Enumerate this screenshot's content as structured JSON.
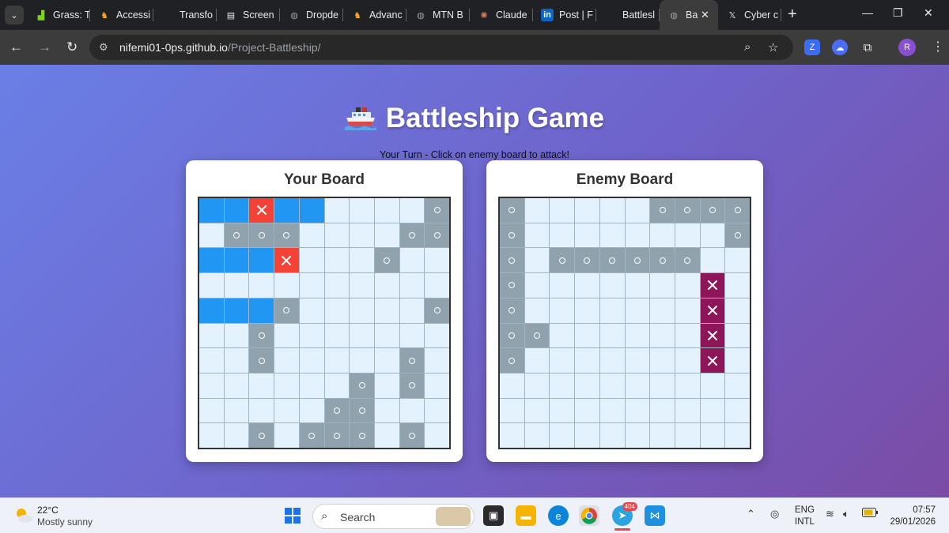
{
  "browser": {
    "tabs": [
      {
        "label": "Grass: T",
        "icon": "grass-icon",
        "color": "#7ed321"
      },
      {
        "label": "Accessi",
        "icon": "fox-icon",
        "color": "#f5a623"
      },
      {
        "label": "Transfo",
        "icon": "blank-icon",
        "color": "#202124"
      },
      {
        "label": "Screen",
        "icon": "screen-icon",
        "color": "#e8eaed"
      },
      {
        "label": "Dropde",
        "icon": "globe-icon",
        "color": "#9aa0a6"
      },
      {
        "label": "Advanc",
        "icon": "fox-icon",
        "color": "#f5a623"
      },
      {
        "label": "MTN B",
        "icon": "globe-icon",
        "color": "#9aa0a6"
      },
      {
        "label": "Claude",
        "icon": "claude-icon",
        "color": "#d97757"
      },
      {
        "label": "Post | F",
        "icon": "linkedin-icon",
        "color": "#0a66c2"
      },
      {
        "label": "Battlesl",
        "icon": "blank-icon",
        "color": "#202124"
      },
      {
        "label": "Ba",
        "icon": "globe-icon",
        "color": "#9aa0a6",
        "active": true
      },
      {
        "label": "Cyber c",
        "icon": "x-icon",
        "color": "#e8eaed"
      }
    ],
    "url_host": "nifemi01-0ps.github.io",
    "url_path": "/Project-Battleship/",
    "profile_initial": "R"
  },
  "page": {
    "title": "Battleship Game",
    "status": "Your Turn - Click on enemy board to attack!"
  },
  "boards": [
    {
      "title": "Your Board",
      "rows": [
        "SSHSS----M",
        "-MMM----MM",
        "SSSH---M--",
        "----------",
        "SSSM-----M",
        "--M-------",
        "--M-----M-",
        "------M-M-",
        "-----MM---",
        "--M-MMM-M-"
      ]
    },
    {
      "title": "Enemy Board",
      "rows": [
        "M-----MMMM",
        "M--------M",
        "M-MMMMMM--",
        "M-------X-",
        "M-------X-",
        "MM------X-",
        "M-------X-",
        "----------",
        "----------",
        "----------"
      ]
    }
  ],
  "legend": {
    "S": "ship",
    "H": "hit",
    "M": "miss",
    "X": "sunk",
    "-": "empty"
  },
  "colors": {
    "ship": "#2196f3",
    "hit": "#f44336",
    "miss": "#8fa2ad",
    "sunk": "#8e1658",
    "water": "#e3f2fc"
  },
  "taskbar": {
    "temperature": "22°C",
    "weather": "Mostly sunny",
    "search_placeholder": "Search",
    "telegram_badge": "404",
    "lang_top": "ENG",
    "lang_bottom": "INTL",
    "time": "07:57",
    "date": "29/01/2026"
  }
}
